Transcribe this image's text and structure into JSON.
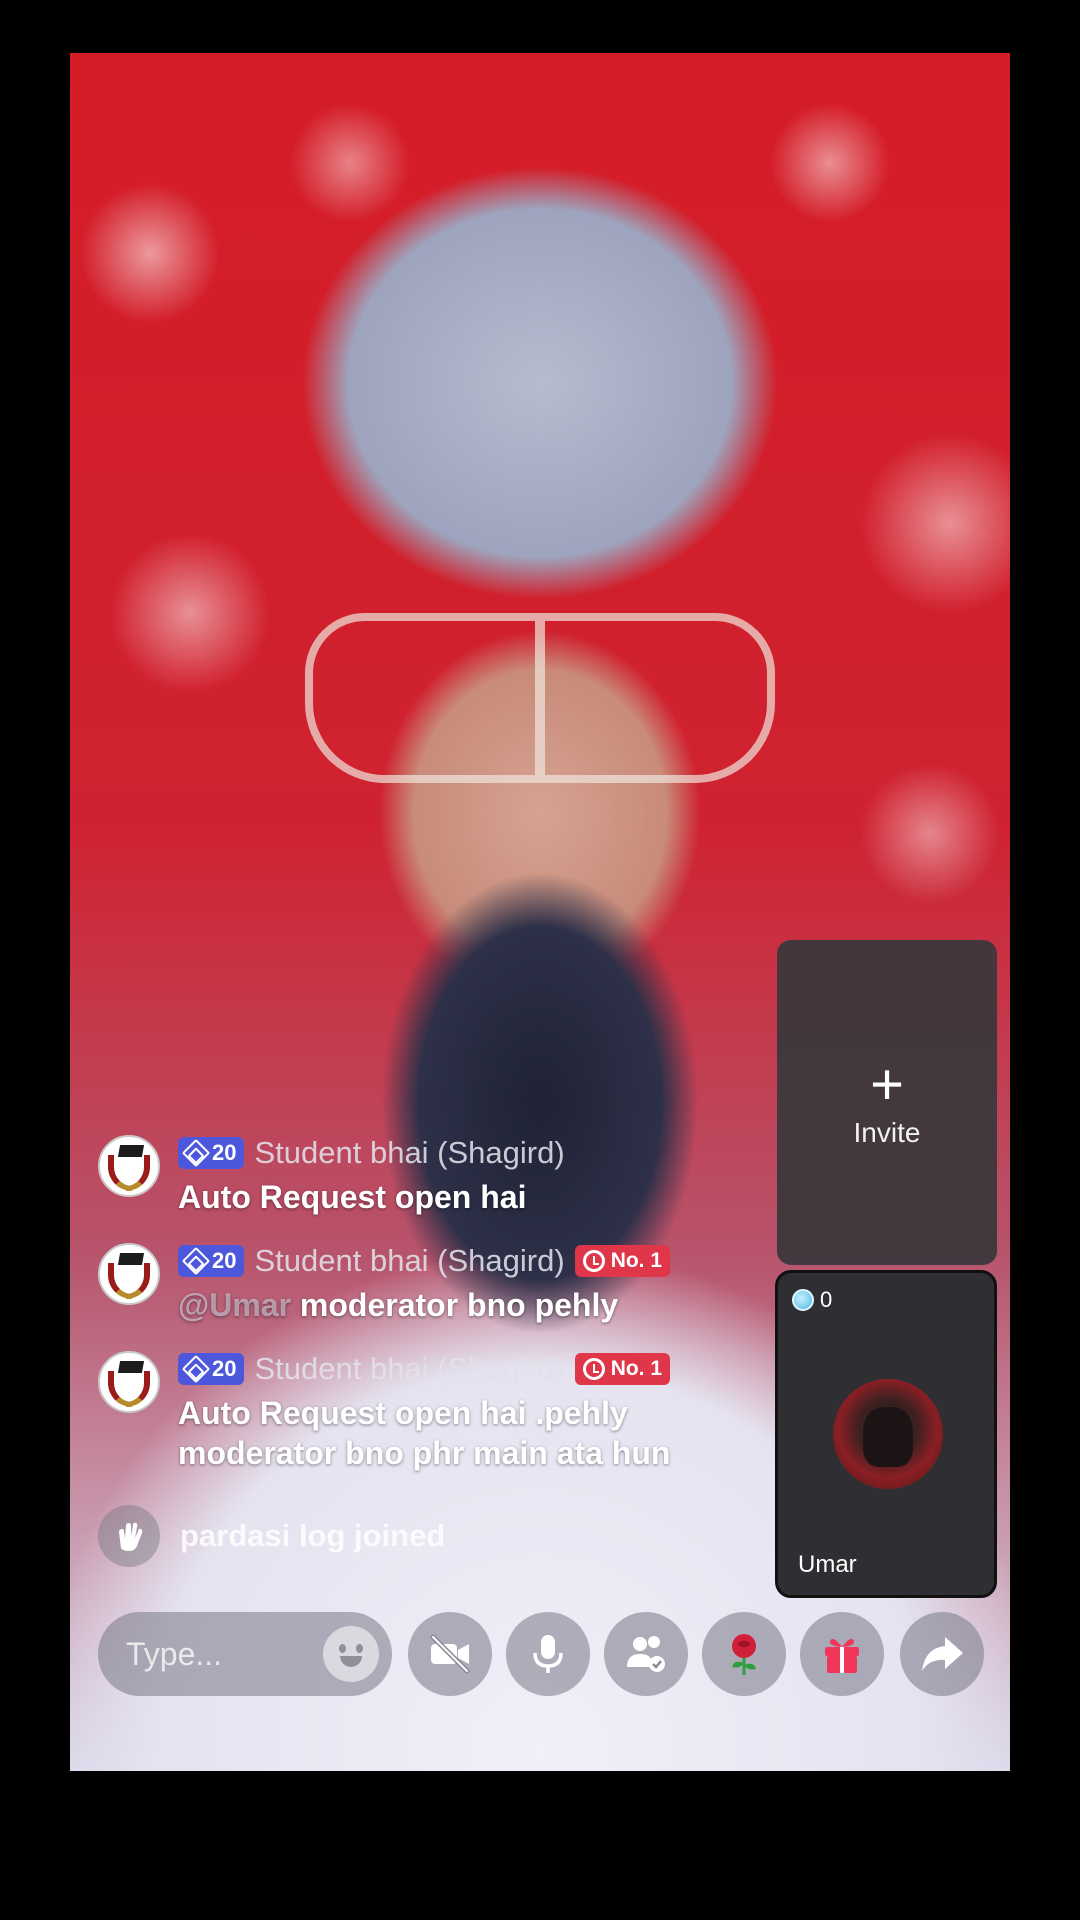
{
  "invite": {
    "plus": "+",
    "label": "Invite"
  },
  "guest": {
    "count": "0",
    "name": "Umar"
  },
  "chat": {
    "messages": [
      {
        "level": "20",
        "username": "Student bhai (Shagird)",
        "rank": "",
        "mention": "",
        "text": "Auto Request open hai"
      },
      {
        "level": "20",
        "username": "Student bhai (Shagird)",
        "rank": "No. 1",
        "mention": "@Umar",
        "text": "moderator bno pehly"
      },
      {
        "level": "20",
        "username": "Student bhai (Shagird)",
        "rank": "No. 1",
        "mention": "",
        "text": "Auto Request open hai .pehly moderator bno phr main ata hun"
      }
    ],
    "join_notice": "pardasi log joined"
  },
  "input": {
    "placeholder": "Type..."
  },
  "actions": [
    {
      "name": "camera-off-button",
      "icon": "video-off-icon"
    },
    {
      "name": "mic-button",
      "icon": "microphone-icon"
    },
    {
      "name": "guests-button",
      "icon": "people-icon"
    },
    {
      "name": "rose-gift-button",
      "icon": "rose-icon"
    },
    {
      "name": "gift-button",
      "icon": "gift-icon"
    },
    {
      "name": "share-button",
      "icon": "share-arrow-icon"
    }
  ],
  "colors": {
    "level_badge": "#4d57dc",
    "rank_badge": "#e0364a",
    "gift": "#f0375a",
    "rose": "#d3203a"
  }
}
